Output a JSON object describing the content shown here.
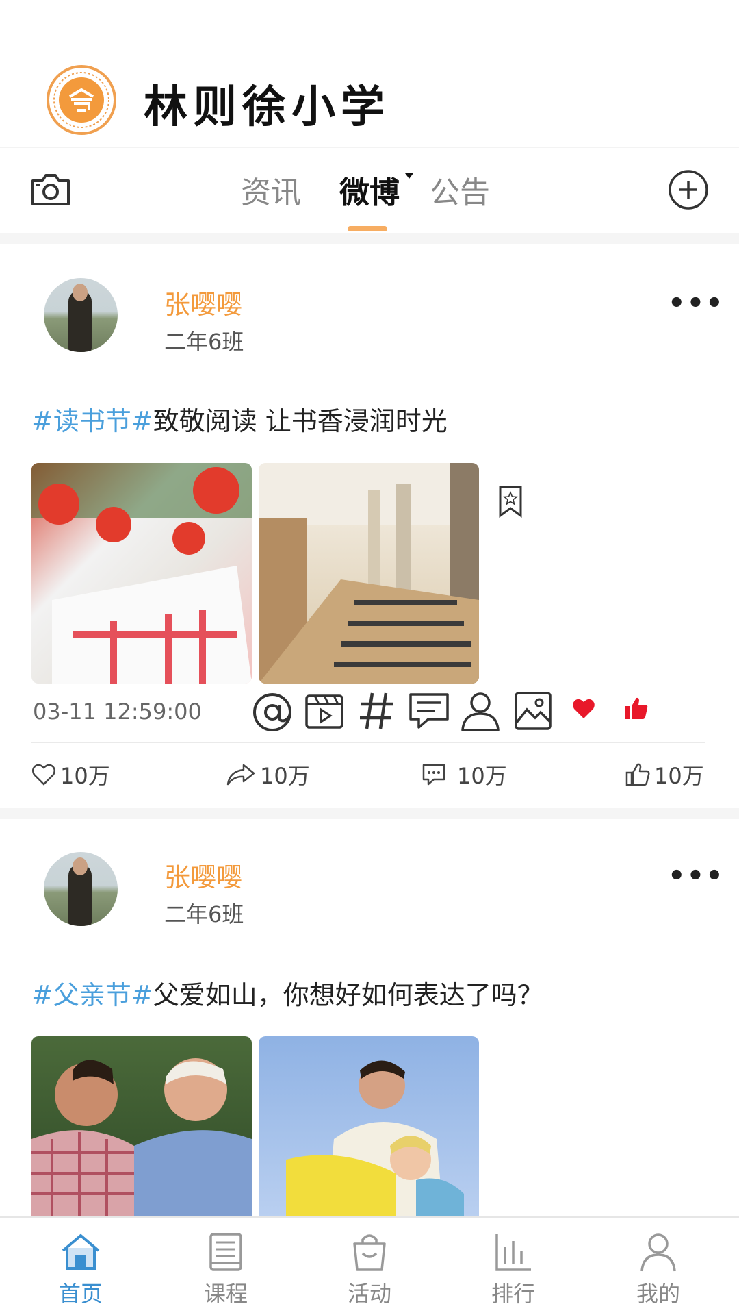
{
  "header": {
    "school_name": "林则徐小学"
  },
  "tabs": {
    "items": [
      "资讯",
      "微博",
      "公告"
    ],
    "active": "微博"
  },
  "posts": [
    {
      "author": "张嘤嘤",
      "class": "二年6班",
      "more": "•••",
      "tag": "#读书节#",
      "text": "致敬阅读 让书香浸润时光",
      "time": "03-11   12:59:00",
      "stats": {
        "likes": "10万",
        "shares": "10万",
        "comments": "10万",
        "thumbs": "10万"
      }
    },
    {
      "author": "张嘤嘤",
      "class": "二年6班",
      "more": "•••",
      "tag": "#父亲节#",
      "text": "父爱如山，你想好如何表达了吗？"
    }
  ],
  "nav": {
    "items": [
      "首页",
      "课程",
      "活动",
      "排行",
      "我的"
    ],
    "active": "首页"
  },
  "colors": {
    "accent": "#f39a3c",
    "tag": "#4a9fdc",
    "nav_active": "#3a8fd0",
    "heart": "#e8182a"
  }
}
